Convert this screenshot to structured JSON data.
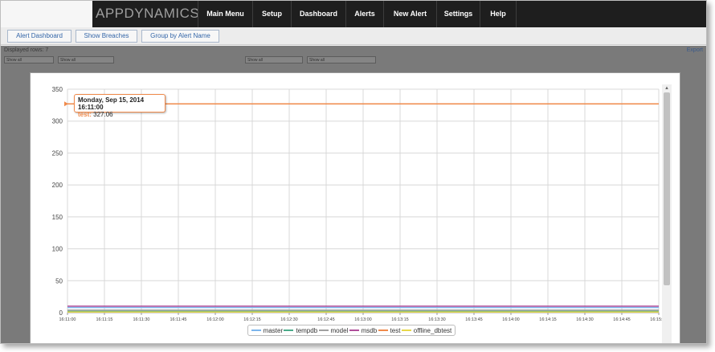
{
  "app": {
    "logo": "APPDYNAMICS"
  },
  "nav": {
    "items": [
      "Main Menu",
      "Setup",
      "Dashboard",
      "Alerts",
      "New Alert",
      "Settings",
      "Help"
    ]
  },
  "toolbar": {
    "buttons": [
      "Alert Dashboard",
      "Show Breaches",
      "Group by Alert Name"
    ]
  },
  "background": {
    "rows_label": "Displayed rows: 7",
    "export": "Export",
    "filters": [
      "Show all",
      "Show all",
      "Show all",
      "Show all"
    ]
  },
  "tooltip": {
    "date": "Monday, Sep 15, 2014 16:11:00",
    "series": "test:",
    "value": "327.06"
  },
  "legend": [
    {
      "name": "master",
      "color": "#7cb5ec"
    },
    {
      "name": "tempdb",
      "color": "#4bab8a"
    },
    {
      "name": "model",
      "color": "#a0a0a0"
    },
    {
      "name": "msdb",
      "color": "#b04f9a"
    },
    {
      "name": "test",
      "color": "#f08a4b"
    },
    {
      "name": "offline_dbtest",
      "color": "#e8d84a"
    }
  ],
  "chart_data": {
    "type": "line",
    "ylim": [
      0,
      350
    ],
    "yticks": [
      "0",
      "50",
      "100",
      "150",
      "200",
      "250",
      "300",
      "350"
    ],
    "x": [
      "16:11:00",
      "16:11:15",
      "16:11:30",
      "16:11:45",
      "16:12:00",
      "16:12:15",
      "16:12:30",
      "16:12:45",
      "16:13:00",
      "16:13:15",
      "16:13:30",
      "16:13:45",
      "16:14:00",
      "16:14:15",
      "16:14:30",
      "16:14:45",
      "16:15:00"
    ],
    "series": [
      {
        "name": "master",
        "color": "#7cb5ec",
        "values": [
          8,
          8,
          8,
          8,
          8,
          8,
          8,
          8,
          8,
          8,
          8,
          8,
          8,
          8,
          8,
          8,
          8
        ]
      },
      {
        "name": "tempdb",
        "color": "#4bab8a",
        "values": [
          2,
          2,
          2,
          2,
          2,
          2,
          2,
          2,
          2,
          2,
          2,
          2,
          2,
          2,
          2,
          2,
          2
        ]
      },
      {
        "name": "model",
        "color": "#a0a0a0",
        "values": [
          4,
          4,
          4,
          4,
          4,
          4,
          4,
          4,
          4,
          4,
          4,
          4,
          4,
          4,
          4,
          4,
          4
        ]
      },
      {
        "name": "msdb",
        "color": "#b04f9a",
        "values": [
          10,
          10,
          10,
          10,
          10,
          10,
          10,
          10,
          10,
          10,
          10,
          10,
          10,
          10,
          10,
          10,
          10
        ]
      },
      {
        "name": "test",
        "color": "#f08a4b",
        "values": [
          327.06,
          327.06,
          327.06,
          327.06,
          327.06,
          327.06,
          327.06,
          327.06,
          327.06,
          327.06,
          327.06,
          327.06,
          327.06,
          327.06,
          327.06,
          327.06,
          327.06
        ]
      },
      {
        "name": "offline_dbtest",
        "color": "#e8d84a",
        "values": [
          1,
          1,
          1,
          1,
          1,
          1,
          1,
          1,
          1,
          1,
          1,
          1,
          1,
          1,
          1,
          1,
          1
        ]
      }
    ]
  }
}
